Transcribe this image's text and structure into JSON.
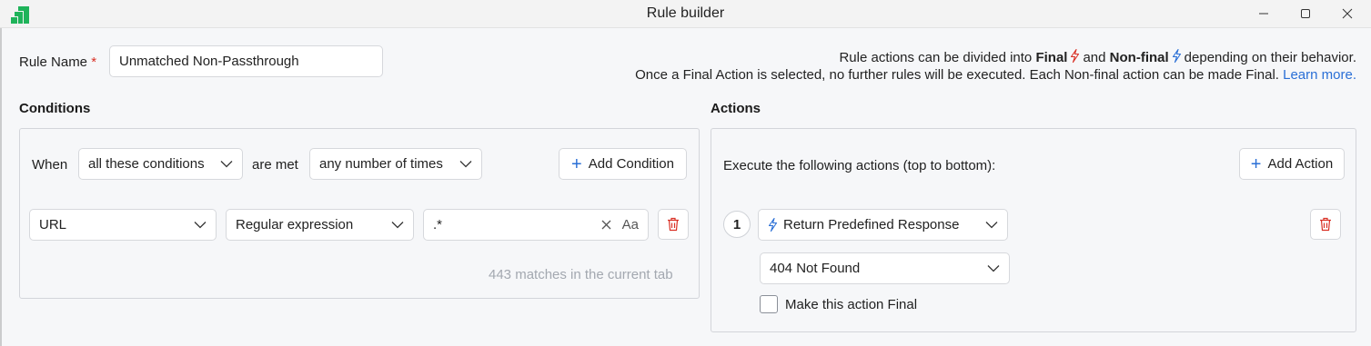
{
  "window": {
    "title": "Rule builder"
  },
  "rule_name": {
    "label": "Rule Name",
    "required_mark": "*",
    "value": "Unmatched Non-Passthrough"
  },
  "info": {
    "line1_prefix": "Rule actions can be divided into",
    "final_label": "Final",
    "and_text": "and",
    "nonfinal_label": "Non-final",
    "line1_suffix": "depending on their behavior.",
    "line2": "Once a Final Action is selected, no further rules will be executed. Each Non-final action can be made Final.",
    "learn_more": "Learn more."
  },
  "conditions": {
    "title": "Conditions",
    "when_label": "When",
    "mode_select": "all these conditions",
    "are_met_label": "are met",
    "times_select": "any number of times",
    "add_button": "Add Condition",
    "rows": [
      {
        "field": "URL",
        "operator": "Regular expression",
        "value": ".*",
        "case_toggle": "Aa"
      }
    ],
    "matches_text": "443 matches in the current tab"
  },
  "actions": {
    "title": "Actions",
    "intro": "Execute the following actions (top to bottom):",
    "add_button": "Add Action",
    "items": [
      {
        "number": "1",
        "type": "Return Predefined Response",
        "response": "404 Not Found",
        "final_checkbox_label": "Make this action Final",
        "final_checked": false
      }
    ]
  },
  "colors": {
    "accent": "#2a6fd6",
    "final": "#d93025",
    "nonfinal": "#2a6fd6",
    "brand": "#1fb35a"
  }
}
